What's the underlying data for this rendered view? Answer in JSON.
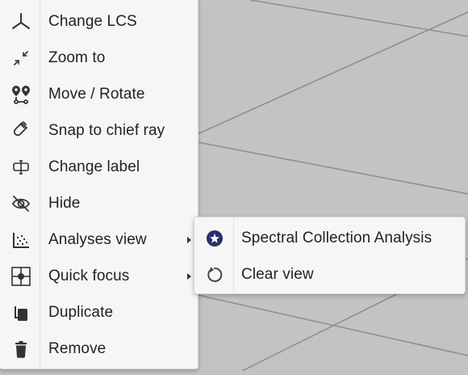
{
  "background_color": "#c3c3c3",
  "context_menu": {
    "items": [
      {
        "label": "Change LCS",
        "icon": "axes-icon"
      },
      {
        "label": "Zoom to",
        "icon": "zoom-to-icon"
      },
      {
        "label": "Move / Rotate",
        "icon": "move-rotate-icon"
      },
      {
        "label": "Snap to chief ray",
        "icon": "magnet-icon"
      },
      {
        "label": "Change label",
        "icon": "label-icon"
      },
      {
        "label": "Hide",
        "icon": "eye-off-icon"
      },
      {
        "label": "Analyses view",
        "icon": "scatter-chart-icon",
        "has_submenu": true
      },
      {
        "label": "Quick focus",
        "icon": "focus-icon",
        "has_submenu": true
      },
      {
        "label": "Duplicate",
        "icon": "duplicate-icon"
      },
      {
        "label": "Remove",
        "icon": "trash-icon"
      }
    ]
  },
  "submenu": {
    "items": [
      {
        "label": "Spectral Collection Analysis",
        "icon": "star-badge-icon"
      },
      {
        "label": "Clear view",
        "icon": "reset-icon"
      }
    ]
  },
  "colors": {
    "icon": "#333333",
    "accent_badge": "#2a2f6b"
  }
}
